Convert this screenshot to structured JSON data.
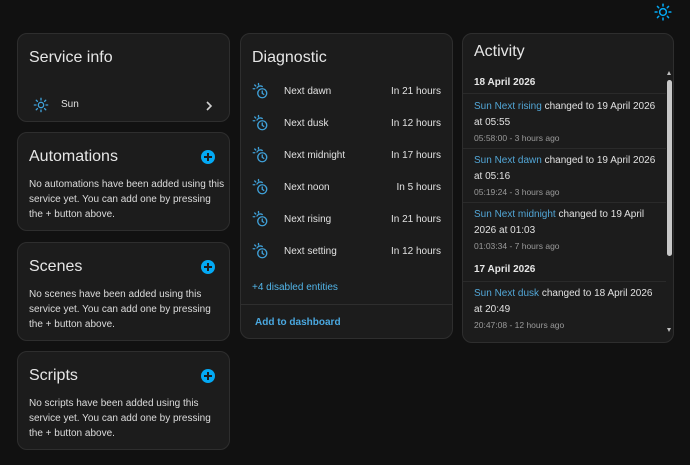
{
  "service_info": {
    "title": "Service info",
    "device_label": "Sun"
  },
  "automations": {
    "title": "Automations",
    "text": "No automations have been added using this service yet. You can add one by pressing the + button above."
  },
  "scenes": {
    "title": "Scenes",
    "text": "No scenes have been added using this service yet. You can add one by pressing the + button above."
  },
  "scripts": {
    "title": "Scripts",
    "text": "No scripts have been added using this service yet. You can add one by pressing the + button above."
  },
  "diagnostic": {
    "title": "Diagnostic",
    "rows": [
      {
        "name": "Next dawn",
        "value": "In 21 hours"
      },
      {
        "name": "Next dusk",
        "value": "In 12 hours"
      },
      {
        "name": "Next midnight",
        "value": "In 17 hours"
      },
      {
        "name": "Next noon",
        "value": "In 5 hours"
      },
      {
        "name": "Next rising",
        "value": "In 21 hours"
      },
      {
        "name": "Next setting",
        "value": "In 12 hours"
      }
    ],
    "disabled_link": "+4 disabled entities",
    "add_button": "Add to dashboard"
  },
  "activity": {
    "title": "Activity",
    "date1": "18 April 2026",
    "date2": "17 April 2026",
    "entries": [
      {
        "entity": "Sun Next rising",
        "text": " changed to 19 April 2026 at 05:55",
        "time": "05:58:00 - 3 hours ago"
      },
      {
        "entity": "Sun Next dawn",
        "text": " changed to 19 April 2026 at 05:16",
        "time": "05:19:24 - 3 hours ago"
      },
      {
        "entity": "Sun Next midnight",
        "text": " changed to 19 April 2026 at 01:03",
        "time": "01:03:34 - 7 hours ago"
      },
      {
        "entity": "Sun Next dusk",
        "text": " changed to 18 April 2026 at 20:49",
        "time": "20:47:08 - 12 hours ago"
      }
    ]
  },
  "colors": {
    "accent": "#03a9f4",
    "link": "#52b5e9",
    "card": "#1c1c1c",
    "background": "#111111"
  },
  "icons": {
    "top": "sun-settings-icon",
    "service": "sun-icon",
    "diagnostic": "sun-clock-icon",
    "add": "plus-circle-icon",
    "chevron": "chevron-right-icon"
  }
}
